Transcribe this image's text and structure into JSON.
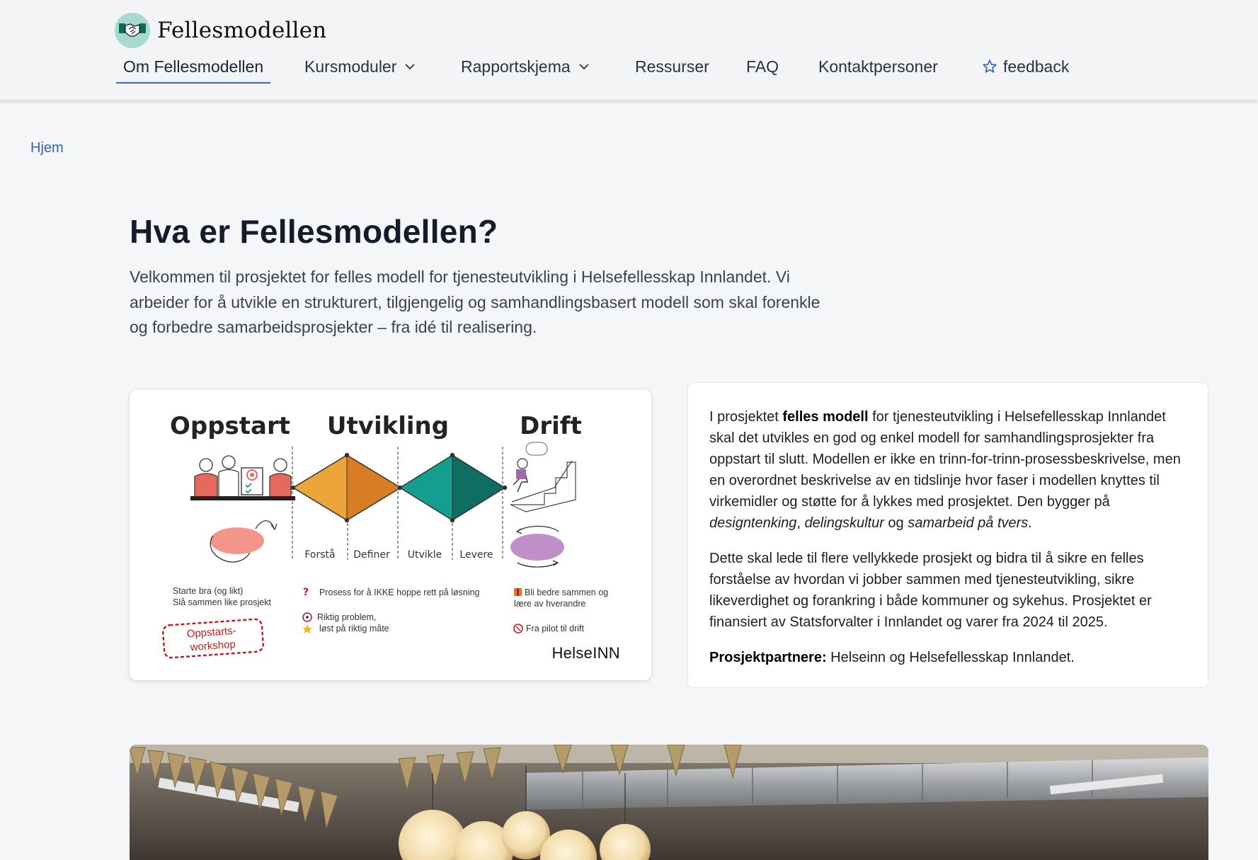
{
  "brand": {
    "name": "Fellesmodellen",
    "logo_icon": "handshake-icon"
  },
  "nav": {
    "items": [
      {
        "label": "Om Fellesmodellen",
        "active": true
      },
      {
        "label": "Kursmoduler",
        "dropdown": true
      },
      {
        "label": "Rapportskjema",
        "dropdown": true
      },
      {
        "label": "Ressurser"
      },
      {
        "label": "FAQ"
      },
      {
        "label": "Kontaktpersoner"
      },
      {
        "label": "feedback",
        "icon": "star-icon"
      }
    ],
    "active_color": "#3c63c6"
  },
  "breadcrumb": {
    "home": "Hjem"
  },
  "hero": {
    "title": "Hva er Fellesmodellen?",
    "intro": "Velkommen til prosjektet for felles modell for tjenesteutvikling i Helsefellesskap Innlandet. Vi arbeider for å utvikle en strukturert, tilgjengelig og samhandlingsbasert modell som skal forenkle og forbedre samarbeidsprosjekter – fra idé til realisering."
  },
  "infographic": {
    "phases": [
      "Oppstart",
      "Utvikling",
      "Drift"
    ],
    "steps": [
      "Forstå",
      "Definer",
      "Utvikle",
      "Levere"
    ],
    "notes": {
      "oppstart_1": "Starte bra (og likt)",
      "oppstart_2": "Slå sammen like prosjekt",
      "utvikling_1": "Prosess for å IKKE hoppe rett på løsning",
      "utvikling_2": "Riktig problem,",
      "utvikling_3": "løst på riktig måte",
      "drift_1": "Bli bedre sammen og",
      "drift_2": "lære av hverandre",
      "drift_3": "Fra pilot til drift"
    },
    "workshop_stamp_1": "Oppstarts-",
    "workshop_stamp_2": "workshop",
    "brand_mark": "HelseINN",
    "colors": {
      "oppstart": "#f3958a",
      "utvikling_left": "#eca53b",
      "utvikling_right": "#d97d24",
      "levere_left": "#149e8f",
      "levere_right": "#0e6e61",
      "drift": "#c08ec9",
      "stamp": "#c21d1d"
    }
  },
  "about": {
    "p1_pre": "I prosjektet ",
    "p1_bold": "felles modell",
    "p1_mid": " for tjenesteutvikling i Helsefellesskap Innlandet skal det utvikles en god og enkel modell for samhandlingsprosjekter fra oppstart til slutt. Modellen er ikke en trinn-for-trinn-prosessbeskrivelse, men en overordnet beskrivelse av en tidslinje hvor faser i modellen knyttes til virkemidler og støtte for å lykkes med prosjektet. Den bygger på ",
    "p1_em1": "designtenking",
    "p1_sep1": ", ",
    "p1_em2": "delingskultur",
    "p1_sep2": " og ",
    "p1_em3": "samarbeid på tvers",
    "p1_end": ".",
    "p2": "Dette skal lede til flere vellykkede prosjekt og bidra til å sikre en felles forståelse av hvordan vi jobber sammen med tjenesteutvikling, sikre likeverdighet og forankring i både kommuner og sykehus. Prosjektet er finansiert av Statsforvalter i Innlandet og varer fra 2024 til 2025.",
    "p3_bold": "Prosjektpartnere:",
    "p3_rest": " Helseinn og Helsefellesskap Innlandet."
  }
}
